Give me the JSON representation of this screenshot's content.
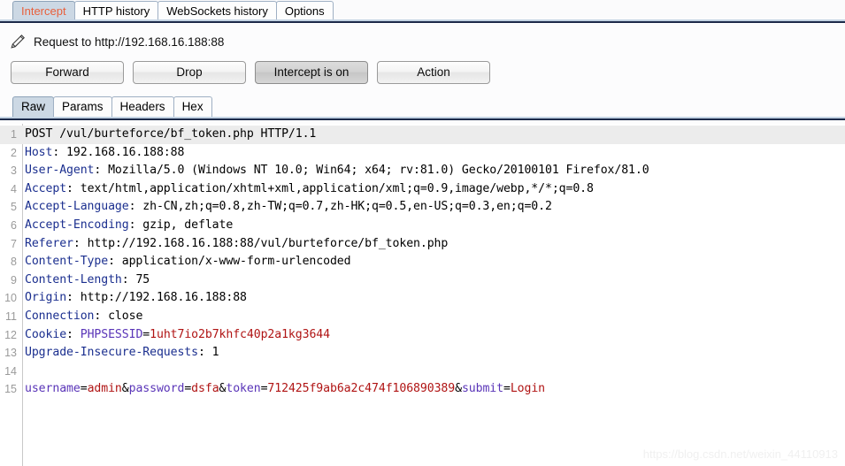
{
  "window": {
    "app": "Burp Suite Proxy"
  },
  "main_tabs": [
    {
      "label": "Intercept",
      "selected": true
    },
    {
      "label": "HTTP history",
      "selected": false
    },
    {
      "label": "WebSockets history",
      "selected": false
    },
    {
      "label": "Options",
      "selected": false
    }
  ],
  "request_bar": {
    "icon": "pencil-icon",
    "label": "Request to http://192.168.16.188:88"
  },
  "buttons": [
    {
      "label": "Forward",
      "pressed": false
    },
    {
      "label": "Drop",
      "pressed": false
    },
    {
      "label": "Intercept is on",
      "pressed": true
    },
    {
      "label": "Action",
      "pressed": false
    }
  ],
  "sub_tabs": [
    {
      "label": "Raw",
      "selected": true
    },
    {
      "label": "Params",
      "selected": false
    },
    {
      "label": "Headers",
      "selected": false
    },
    {
      "label": "Hex",
      "selected": false
    }
  ],
  "editor": {
    "current_line": 1,
    "lines": [
      {
        "n": "1",
        "segments": [
          {
            "t": "POST /vul/burteforce/bf_token.php HTTP/1.1",
            "c": "hv"
          }
        ]
      },
      {
        "n": "2",
        "segments": [
          {
            "t": "Host",
            "c": "hk"
          },
          {
            "t": ": 192.168.16.188:88",
            "c": "hv"
          }
        ]
      },
      {
        "n": "3",
        "segments": [
          {
            "t": "User-Agent",
            "c": "hk"
          },
          {
            "t": ": Mozilla/5.0 (Windows NT 10.0; Win64; x64; rv:81.0) Gecko/20100101 Firefox/81.0",
            "c": "hv"
          }
        ]
      },
      {
        "n": "4",
        "segments": [
          {
            "t": "Accept",
            "c": "hk"
          },
          {
            "t": ": text/html,application/xhtml+xml,application/xml;q=0.9,image/webp,*/*;q=0.8",
            "c": "hv"
          }
        ]
      },
      {
        "n": "5",
        "segments": [
          {
            "t": "Accept-Language",
            "c": "hk"
          },
          {
            "t": ": zh-CN,zh;q=0.8,zh-TW;q=0.7,zh-HK;q=0.5,en-US;q=0.3,en;q=0.2",
            "c": "hv"
          }
        ]
      },
      {
        "n": "6",
        "segments": [
          {
            "t": "Accept-Encoding",
            "c": "hk"
          },
          {
            "t": ": gzip, deflate",
            "c": "hv"
          }
        ]
      },
      {
        "n": "7",
        "segments": [
          {
            "t": "Referer",
            "c": "hk"
          },
          {
            "t": ": http://192.168.16.188:88/vul/burteforce/bf_token.php",
            "c": "hv"
          }
        ]
      },
      {
        "n": "8",
        "segments": [
          {
            "t": "Content-Type",
            "c": "hk"
          },
          {
            "t": ": application/x-www-form-urlencoded",
            "c": "hv"
          }
        ]
      },
      {
        "n": "9",
        "segments": [
          {
            "t": "Content-Length",
            "c": "hk"
          },
          {
            "t": ": 75",
            "c": "hv"
          }
        ]
      },
      {
        "n": "10",
        "segments": [
          {
            "t": "Origin",
            "c": "hk"
          },
          {
            "t": ": http://192.168.16.188:88",
            "c": "hv"
          }
        ]
      },
      {
        "n": "11",
        "segments": [
          {
            "t": "Connection",
            "c": "hk"
          },
          {
            "t": ": close",
            "c": "hv"
          }
        ]
      },
      {
        "n": "12",
        "segments": [
          {
            "t": "Cookie",
            "c": "hk"
          },
          {
            "t": ": ",
            "c": "hv"
          },
          {
            "t": "PHPSESSID",
            "c": "pk"
          },
          {
            "t": "=",
            "c": "amp"
          },
          {
            "t": "1uht7io2b7khfc40p2a1kg3644",
            "c": "pv"
          }
        ]
      },
      {
        "n": "13",
        "segments": [
          {
            "t": "Upgrade-Insecure-Requests",
            "c": "hk"
          },
          {
            "t": ": 1",
            "c": "hv"
          }
        ]
      },
      {
        "n": "14",
        "segments": [
          {
            "t": "",
            "c": "hv"
          }
        ]
      },
      {
        "n": "15",
        "segments": [
          {
            "t": "username",
            "c": "pk"
          },
          {
            "t": "=",
            "c": "amp"
          },
          {
            "t": "admin",
            "c": "pv"
          },
          {
            "t": "&",
            "c": "amp"
          },
          {
            "t": "password",
            "c": "pk"
          },
          {
            "t": "=",
            "c": "amp"
          },
          {
            "t": "dsfa",
            "c": "pv"
          },
          {
            "t": "&",
            "c": "amp"
          },
          {
            "t": "token",
            "c": "pk"
          },
          {
            "t": "=",
            "c": "amp"
          },
          {
            "t": "712425f9ab6a2c474f106890389",
            "c": "pv"
          },
          {
            "t": "&",
            "c": "amp"
          },
          {
            "t": "submit",
            "c": "pk"
          },
          {
            "t": "=",
            "c": "amp"
          },
          {
            "t": "Login",
            "c": "pv"
          }
        ]
      }
    ]
  },
  "watermark": {
    "text": "https://blog.csdn.net/weixin_44110913"
  },
  "colors": {
    "selected_tab_bg": "#ccd8e4",
    "intercept_tab_text": "#e8603c",
    "header_key": "#1b2f8f",
    "param_key": "#5a35b8",
    "param_value": "#b01414",
    "divider_dark": "#1d2b4a"
  }
}
